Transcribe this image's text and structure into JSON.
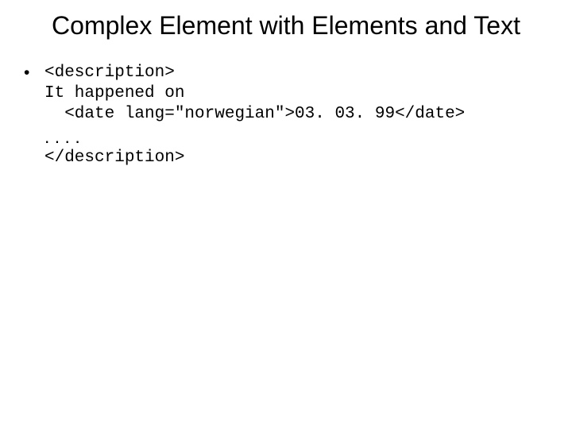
{
  "title": "Complex Element with Elements and Text",
  "bullet_glyph": "•",
  "code": {
    "l1": "<description>",
    "l2": "It happened on",
    "l3": "  <date lang=\"norwegian\">03. 03. 99</date>",
    "dots": ". . . .",
    "l5": "</description>"
  }
}
